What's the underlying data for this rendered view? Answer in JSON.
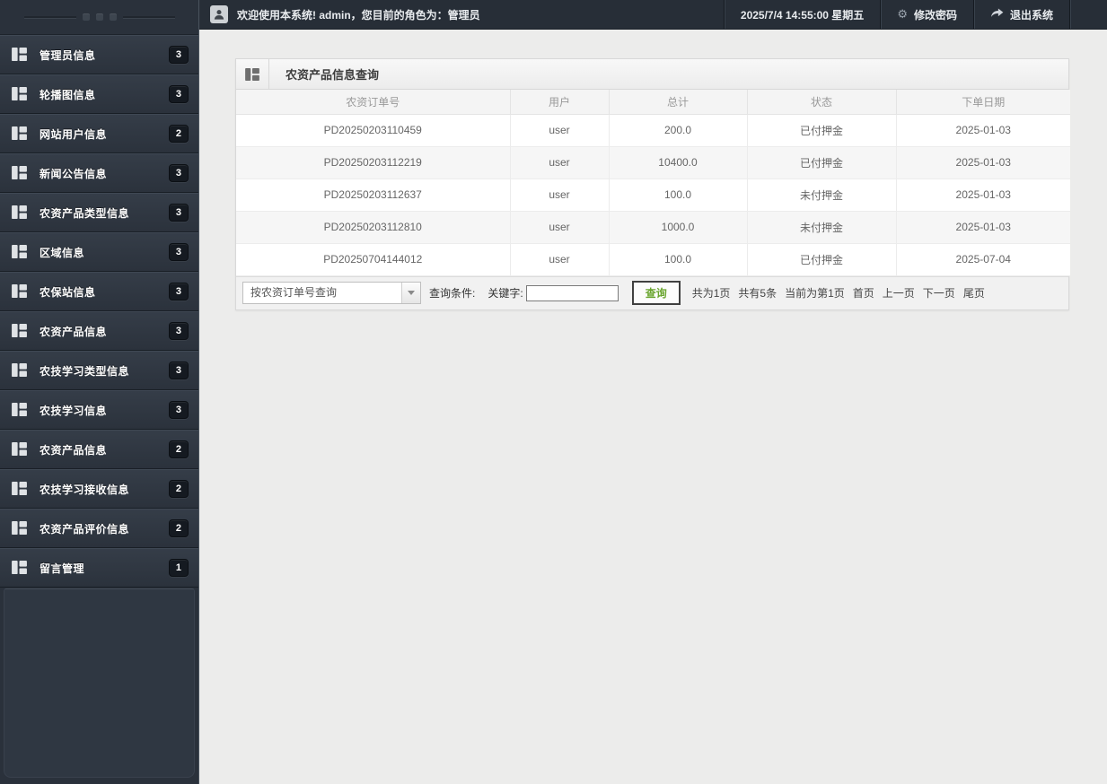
{
  "header": {
    "welcome": "欢迎使用本系统! admin，您目前的角色为：管理员",
    "datetime": "2025/7/4 14:55:00 星期五",
    "change_password": "修改密码",
    "logout": "退出系统"
  },
  "sidebar": {
    "items": [
      {
        "label": "管理员信息",
        "badge": "3"
      },
      {
        "label": "轮播图信息",
        "badge": "3"
      },
      {
        "label": "网站用户信息",
        "badge": "2"
      },
      {
        "label": "新闻公告信息",
        "badge": "3"
      },
      {
        "label": "农资产品类型信息",
        "badge": "3"
      },
      {
        "label": "区域信息",
        "badge": "3"
      },
      {
        "label": "农保站信息",
        "badge": "3"
      },
      {
        "label": "农资产品信息",
        "badge": "3"
      },
      {
        "label": "农技学习类型信息",
        "badge": "3"
      },
      {
        "label": "农技学习信息",
        "badge": "3"
      },
      {
        "label": "农资产品信息",
        "badge": "2"
      },
      {
        "label": "农技学习接收信息",
        "badge": "2"
      },
      {
        "label": "农资产品评价信息",
        "badge": "2"
      },
      {
        "label": "留言管理",
        "badge": "1"
      }
    ]
  },
  "panel": {
    "title": "农资产品信息查询",
    "table": {
      "columns": [
        "农资订单号",
        "用户",
        "总计",
        "状态",
        "下单日期"
      ],
      "rows": [
        [
          "PD20250203110459",
          "user",
          "200.0",
          "已付押金",
          "2025-01-03"
        ],
        [
          "PD20250203112219",
          "user",
          "10400.0",
          "已付押金",
          "2025-01-03"
        ],
        [
          "PD20250203112637",
          "user",
          "100.0",
          "未付押金",
          "2025-01-03"
        ],
        [
          "PD20250203112810",
          "user",
          "1000.0",
          "未付押金",
          "2025-01-03"
        ],
        [
          "PD20250704144012",
          "user",
          "100.0",
          "已付押金",
          "2025-07-04"
        ]
      ]
    },
    "toolbar": {
      "filter_select": "按农资订单号查询",
      "condition_label": "查询条件:",
      "keyword_label": "关键字:",
      "keyword_value": "",
      "search_button": "查询",
      "pagination": {
        "total_pages": "共为1页",
        "total_records": "共有5条",
        "current_page": "当前为第1页",
        "first": "首页",
        "prev": "上一页",
        "next": "下一页",
        "last": "尾页"
      }
    }
  },
  "icons": {
    "sidebar_item": "grid-icon",
    "panel_header": "grid-icon",
    "topbar_user": "user-avatar-icon",
    "change_password": "gear-icon",
    "logout": "forward-arrow-icon",
    "filter_dropdown": "chevron-down-icon"
  },
  "colors": {
    "sidebar_bg": "#2a313b",
    "topbar_bg": "#272e37",
    "main_bg": "#ececeb",
    "panel_header_bg": "#f2f2f2",
    "accent_green": "#6aa52f",
    "badge_bg": "#151a21"
  }
}
